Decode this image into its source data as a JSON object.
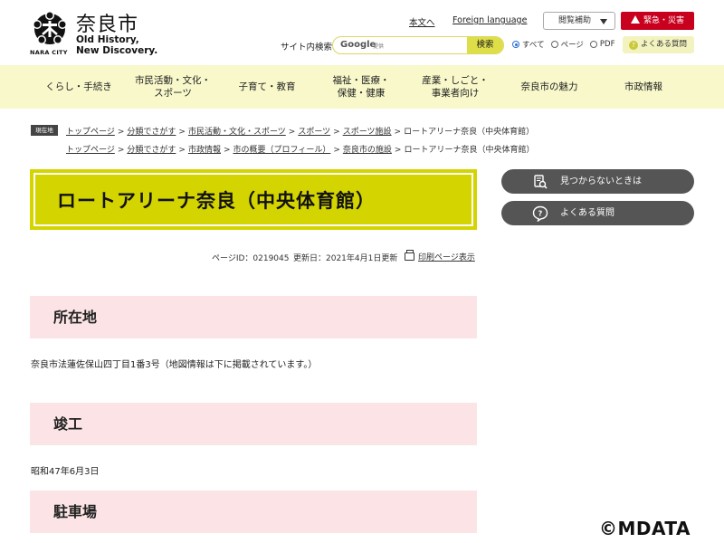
{
  "header": {
    "logo_name": "奈良市",
    "logo_sub1": "Old History,",
    "logo_sub2": "New Discovery.",
    "logo_city": "NARA CITY",
    "link_honbun": "本文へ",
    "link_foreign": "Foreign language",
    "assist_label": "閲覧補助",
    "emergency_label": "緊急・災害",
    "search_label": "サイト内検索",
    "search_google": "Google",
    "search_teikyo": "提供",
    "search_button": "検索",
    "radio_options": [
      "すべて",
      "ページ",
      "PDF"
    ],
    "faq_label": "よくある質問"
  },
  "nav": {
    "items": [
      "くらし・手続き",
      "市民活動・文化・\nスポーツ",
      "子育て・教育",
      "福祉・医療・\n保健・健康",
      "産業・しごと・\n事業者向け",
      "奈良市の魅力",
      "市政情報"
    ]
  },
  "breadcrumb": {
    "tag": "現在地",
    "row1": [
      "トップページ",
      "分類でさがす",
      "市民活動・文化・スポーツ",
      "スポーツ",
      "スポーツ施設"
    ],
    "row1_current": "ロートアリーナ奈良（中央体育館）",
    "row2": [
      "トップページ",
      "分類でさがす",
      "市政情報",
      "市の概要（プロフィール）",
      "奈良市の施設"
    ],
    "row2_current": "ロートアリーナ奈良（中央体育館）",
    "separator": ">"
  },
  "page": {
    "title": "ロートアリーナ奈良（中央体育館）",
    "page_id": "ページID：0219045",
    "updated": "更新日：2021年4月1日更新",
    "print_label": "印刷ページ表示"
  },
  "sidebar": {
    "not_found": "見つからないときは",
    "faq": "よくある質問"
  },
  "sections": {
    "location_heading": "所在地",
    "location_text": "奈良市法蓮佐保山四丁目1番3号（地図情報は下に掲載されています。）",
    "completion_heading": "竣工",
    "completion_text": "昭和47年6月3日",
    "parking_heading": "駐車場"
  },
  "watermark": "©MDATA",
  "colors": {
    "nav_bg": "#f8f8cb",
    "title_bg": "#d4d400",
    "section_bg": "#fce4e6",
    "emergency": "#c8001e",
    "side_button": "#555555"
  }
}
